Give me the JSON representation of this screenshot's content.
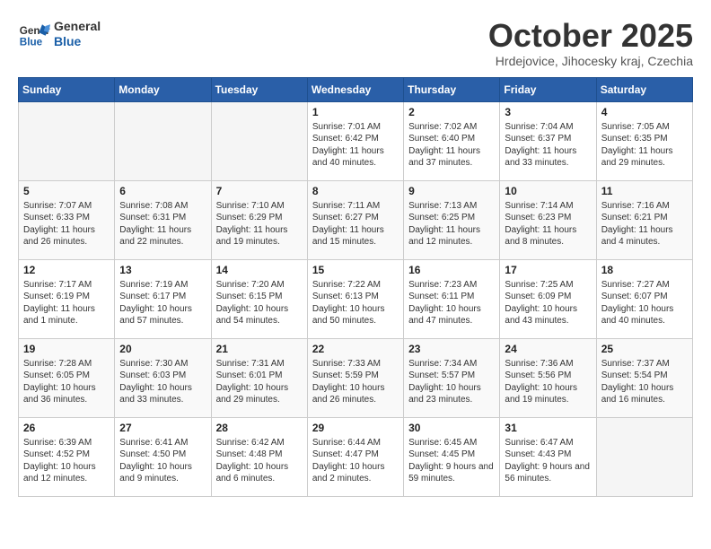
{
  "header": {
    "logo_line1": "General",
    "logo_line2": "Blue",
    "month": "October 2025",
    "location": "Hrdejovice, Jihocesky kraj, Czechia"
  },
  "weekdays": [
    "Sunday",
    "Monday",
    "Tuesday",
    "Wednesday",
    "Thursday",
    "Friday",
    "Saturday"
  ],
  "weeks": [
    [
      {
        "day": "",
        "info": ""
      },
      {
        "day": "",
        "info": ""
      },
      {
        "day": "",
        "info": ""
      },
      {
        "day": "1",
        "info": "Sunrise: 7:01 AM\nSunset: 6:42 PM\nDaylight: 11 hours and 40 minutes."
      },
      {
        "day": "2",
        "info": "Sunrise: 7:02 AM\nSunset: 6:40 PM\nDaylight: 11 hours and 37 minutes."
      },
      {
        "day": "3",
        "info": "Sunrise: 7:04 AM\nSunset: 6:37 PM\nDaylight: 11 hours and 33 minutes."
      },
      {
        "day": "4",
        "info": "Sunrise: 7:05 AM\nSunset: 6:35 PM\nDaylight: 11 hours and 29 minutes."
      }
    ],
    [
      {
        "day": "5",
        "info": "Sunrise: 7:07 AM\nSunset: 6:33 PM\nDaylight: 11 hours and 26 minutes."
      },
      {
        "day": "6",
        "info": "Sunrise: 7:08 AM\nSunset: 6:31 PM\nDaylight: 11 hours and 22 minutes."
      },
      {
        "day": "7",
        "info": "Sunrise: 7:10 AM\nSunset: 6:29 PM\nDaylight: 11 hours and 19 minutes."
      },
      {
        "day": "8",
        "info": "Sunrise: 7:11 AM\nSunset: 6:27 PM\nDaylight: 11 hours and 15 minutes."
      },
      {
        "day": "9",
        "info": "Sunrise: 7:13 AM\nSunset: 6:25 PM\nDaylight: 11 hours and 12 minutes."
      },
      {
        "day": "10",
        "info": "Sunrise: 7:14 AM\nSunset: 6:23 PM\nDaylight: 11 hours and 8 minutes."
      },
      {
        "day": "11",
        "info": "Sunrise: 7:16 AM\nSunset: 6:21 PM\nDaylight: 11 hours and 4 minutes."
      }
    ],
    [
      {
        "day": "12",
        "info": "Sunrise: 7:17 AM\nSunset: 6:19 PM\nDaylight: 11 hours and 1 minute."
      },
      {
        "day": "13",
        "info": "Sunrise: 7:19 AM\nSunset: 6:17 PM\nDaylight: 10 hours and 57 minutes."
      },
      {
        "day": "14",
        "info": "Sunrise: 7:20 AM\nSunset: 6:15 PM\nDaylight: 10 hours and 54 minutes."
      },
      {
        "day": "15",
        "info": "Sunrise: 7:22 AM\nSunset: 6:13 PM\nDaylight: 10 hours and 50 minutes."
      },
      {
        "day": "16",
        "info": "Sunrise: 7:23 AM\nSunset: 6:11 PM\nDaylight: 10 hours and 47 minutes."
      },
      {
        "day": "17",
        "info": "Sunrise: 7:25 AM\nSunset: 6:09 PM\nDaylight: 10 hours and 43 minutes."
      },
      {
        "day": "18",
        "info": "Sunrise: 7:27 AM\nSunset: 6:07 PM\nDaylight: 10 hours and 40 minutes."
      }
    ],
    [
      {
        "day": "19",
        "info": "Sunrise: 7:28 AM\nSunset: 6:05 PM\nDaylight: 10 hours and 36 minutes."
      },
      {
        "day": "20",
        "info": "Sunrise: 7:30 AM\nSunset: 6:03 PM\nDaylight: 10 hours and 33 minutes."
      },
      {
        "day": "21",
        "info": "Sunrise: 7:31 AM\nSunset: 6:01 PM\nDaylight: 10 hours and 29 minutes."
      },
      {
        "day": "22",
        "info": "Sunrise: 7:33 AM\nSunset: 5:59 PM\nDaylight: 10 hours and 26 minutes."
      },
      {
        "day": "23",
        "info": "Sunrise: 7:34 AM\nSunset: 5:57 PM\nDaylight: 10 hours and 23 minutes."
      },
      {
        "day": "24",
        "info": "Sunrise: 7:36 AM\nSunset: 5:56 PM\nDaylight: 10 hours and 19 minutes."
      },
      {
        "day": "25",
        "info": "Sunrise: 7:37 AM\nSunset: 5:54 PM\nDaylight: 10 hours and 16 minutes."
      }
    ],
    [
      {
        "day": "26",
        "info": "Sunrise: 6:39 AM\nSunset: 4:52 PM\nDaylight: 10 hours and 12 minutes."
      },
      {
        "day": "27",
        "info": "Sunrise: 6:41 AM\nSunset: 4:50 PM\nDaylight: 10 hours and 9 minutes."
      },
      {
        "day": "28",
        "info": "Sunrise: 6:42 AM\nSunset: 4:48 PM\nDaylight: 10 hours and 6 minutes."
      },
      {
        "day": "29",
        "info": "Sunrise: 6:44 AM\nSunset: 4:47 PM\nDaylight: 10 hours and 2 minutes."
      },
      {
        "day": "30",
        "info": "Sunrise: 6:45 AM\nSunset: 4:45 PM\nDaylight: 9 hours and 59 minutes."
      },
      {
        "day": "31",
        "info": "Sunrise: 6:47 AM\nSunset: 4:43 PM\nDaylight: 9 hours and 56 minutes."
      },
      {
        "day": "",
        "info": ""
      }
    ]
  ]
}
